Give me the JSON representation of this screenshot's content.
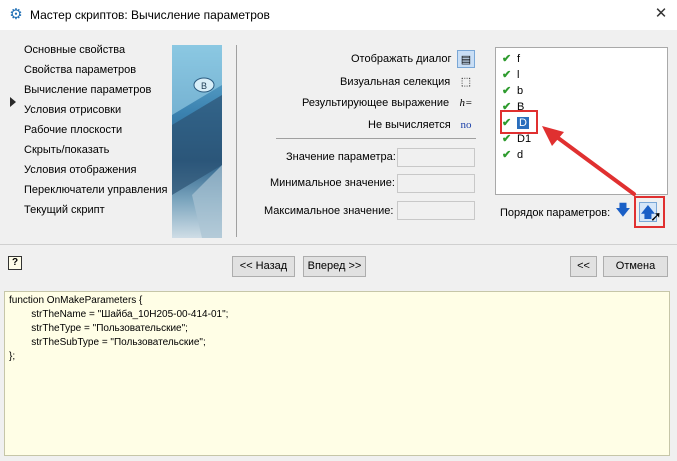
{
  "window": {
    "title": "Мастер скриптов:  Вычисление параметров",
    "close_symbol": "✕",
    "icon": "gear-icon"
  },
  "nav": {
    "items": [
      {
        "label": "Основные свойства",
        "active": false
      },
      {
        "label": "Свойства параметров",
        "active": false
      },
      {
        "label": "Вычисление параметров",
        "active": true
      },
      {
        "label": "Условия отрисовки",
        "active": false
      },
      {
        "label": "Рабочие плоскости",
        "active": false
      },
      {
        "label": "Скрыть/показать",
        "active": false
      },
      {
        "label": "Условия отображения",
        "active": false
      },
      {
        "label": "Переключатели управления",
        "active": false
      },
      {
        "label": "Текущий скрипт",
        "active": false
      }
    ]
  },
  "options": {
    "show_dialog": {
      "label": "Отображать диалог",
      "icon": "dialog-icon",
      "glyph": "▤",
      "selected": true
    },
    "visual_selection": {
      "label": "Визуальная селекция",
      "icon": "selection-icon",
      "glyph": "⬚"
    },
    "result_expression": {
      "label": "Результирующее выражение",
      "icon": "expression-icon",
      "glyph": "h="
    },
    "not_computed": {
      "label": "Не вычисляется",
      "value": "no"
    }
  },
  "fields": {
    "param_value": {
      "label": "Значение параметра:",
      "value": ""
    },
    "min_value": {
      "label": "Минимальное значение:",
      "value": ""
    },
    "max_value": {
      "label": "Максимальное значение:",
      "value": ""
    }
  },
  "params": {
    "items": [
      {
        "name": "f",
        "checked": true,
        "selected": false
      },
      {
        "name": "l",
        "checked": true,
        "selected": false
      },
      {
        "name": "b",
        "checked": true,
        "selected": false
      },
      {
        "name": "B",
        "checked": true,
        "selected": false
      },
      {
        "name": "D",
        "checked": true,
        "selected": true
      },
      {
        "name": "D1",
        "checked": true,
        "selected": false
      },
      {
        "name": "d",
        "checked": true,
        "selected": false
      }
    ],
    "check_glyph": "✔",
    "order_label": "Порядок параметров:",
    "down_glyph": "🡇",
    "up_glyph": "🡅"
  },
  "buttons": {
    "back": "<< Назад",
    "forward": "Вперед >>",
    "rewind": "<<",
    "cancel": "Отмена",
    "help": "?"
  },
  "code": {
    "lines": [
      "function OnMakeParameters {",
      "        strTheName = \"Шайба_10H205-00-414-01\";",
      "        strTheType = \"Пользовательские\";",
      "        strTheSubType = \"Пользовательские\";",
      "};"
    ]
  },
  "colors": {
    "highlight_red": "#e03030",
    "selection_blue": "#2a6ebd",
    "check_green": "#2e9b2e"
  }
}
